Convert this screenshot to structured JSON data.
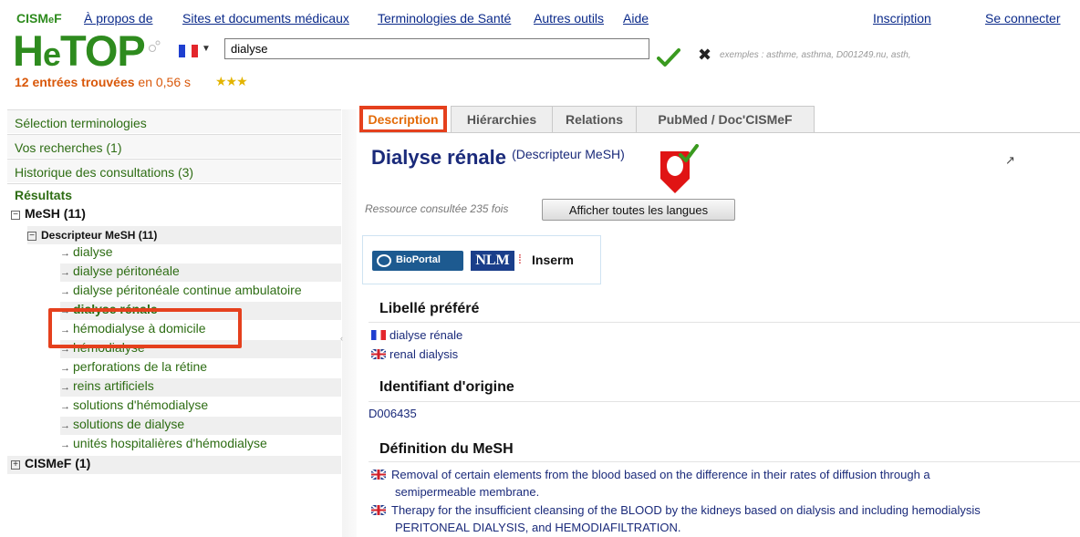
{
  "topbar": {
    "brand_prefix": "CISM",
    "brand_e": "e",
    "brand_suffix": "F",
    "nav": [
      "À propos de",
      "Sites et documents médicaux",
      "Terminologies de Santé",
      "Autres outils",
      "Aide"
    ],
    "signup": "Inscription",
    "login": "Se connecter"
  },
  "header": {
    "logo_h": "H",
    "logo_e": "e",
    "logo_top": "TOP",
    "search_value": "dialyse",
    "examples": "exemples : asthme, asthma, D001249.nu, asth,",
    "results_count": "12 entrées trouvées",
    "results_time": " en 0,56 s",
    "stars": "★★★"
  },
  "sidebar": {
    "items": [
      "Sélection terminologies",
      "Vos recherches (1)",
      "Historique des consultations (3)"
    ],
    "results_label": "Résultats",
    "tree": {
      "root1_toggle": "−",
      "root1_label": "MeSH (11)",
      "sub_toggle": "−",
      "sub_label": "Descripteur MeSH (11)",
      "leaf_arrow": "→",
      "leaves": [
        "dialyse",
        "dialyse péritonéale",
        "dialyse péritonéale continue ambulatoire",
        "dialyse rénale",
        "hémodialyse à domicile",
        "hémodialyse",
        "perforations de la rétine",
        "reins artificiels",
        "solutions d'hémodialyse",
        "solutions de dialyse",
        "unités hospitalières d'hémodialyse"
      ],
      "root2_toggle": "+",
      "root2_label": "CISMeF (1)"
    }
  },
  "tabs": [
    "Description",
    "Hiérarchies",
    "Relations",
    "PubMed / Doc'CISMeF"
  ],
  "detail": {
    "title": "Dialyse rénale",
    "type": "(Descripteur MeSH)",
    "external_icon": "↗",
    "consulted": "Ressource consultée 235 fois",
    "show_languages": "Afficher toutes les langues",
    "partners": {
      "bioportal": "BioPortal",
      "nlm": "NLM",
      "inserm": "Inserm"
    },
    "preferred_heading": "Libellé préféré",
    "preferred_fr": "dialyse rénale",
    "preferred_en": "renal dialysis",
    "origin_heading": "Identifiant d'origine",
    "origin_id": "D006435",
    "definition_heading": "Définition du MeSH",
    "def1_a": "Removal of certain elements from the blood based on the difference in their rates of diffusion through a",
    "def1_b": "semipermeable membrane.",
    "def2_a": "Therapy for the insufficient cleansing of the BLOOD by the kidneys based on dialysis and including hemodialysis",
    "def2_b": "PERITONEAL DIALYSIS, and HEMODIAFILTRATION."
  },
  "colors": {
    "brand_green": "#2e8b1e",
    "link_blue": "#0b2a8a",
    "orange": "#d9580a",
    "highlight_red": "#e5401d"
  }
}
